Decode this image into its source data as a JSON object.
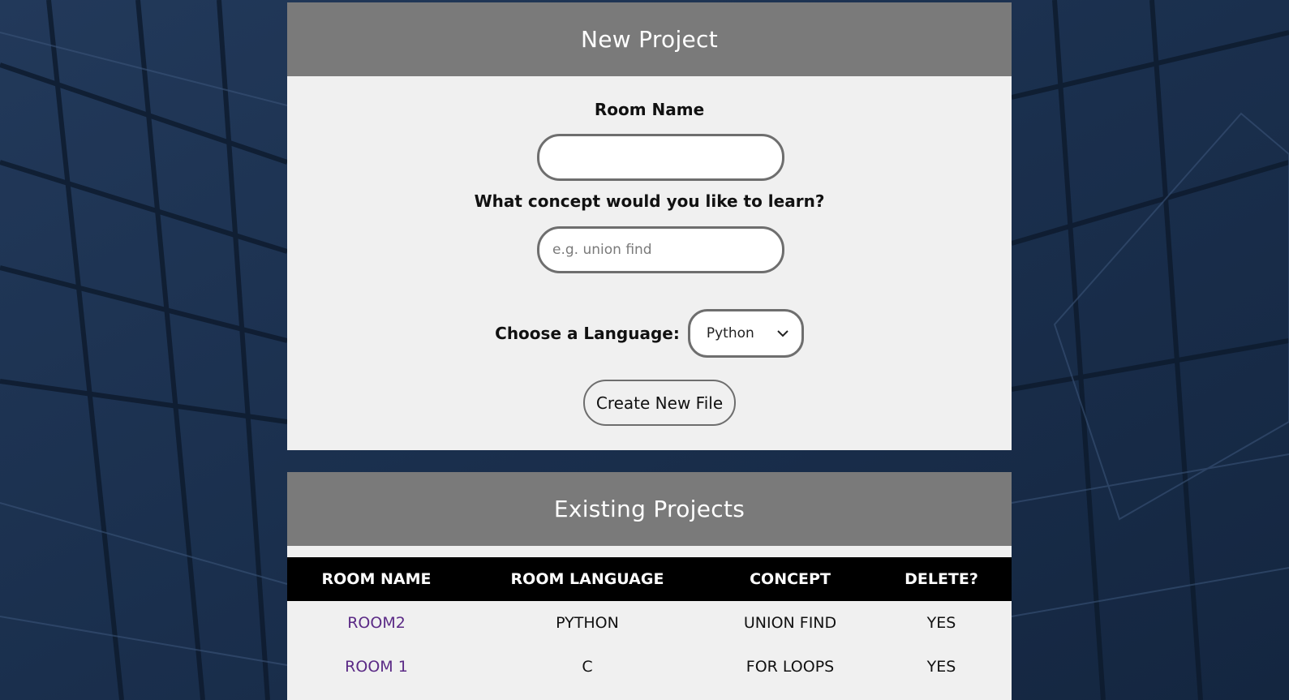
{
  "new_project": {
    "title": "New Project",
    "room_name_label": "Room Name",
    "room_name_value": "",
    "concept_label": "What concept would you like to learn?",
    "concept_placeholder": "e.g. union find",
    "language_label": "Choose a Language:",
    "language_selected": "Python",
    "create_button": "Create New File"
  },
  "existing_projects": {
    "title": "Existing Projects",
    "columns": [
      "ROOM NAME",
      "ROOM LANGUAGE",
      "CONCEPT",
      "DELETE?"
    ],
    "rows": [
      {
        "name": "ROOM2",
        "language": "PYTHON",
        "concept": "UNION FIND",
        "delete": "YES"
      },
      {
        "name": "ROOM 1",
        "language": "C",
        "concept": "FOR LOOPS",
        "delete": "YES"
      }
    ]
  },
  "colors": {
    "header_bg": "#7a7a7a",
    "panel_bg": "#f0f0f0",
    "table_header_bg": "#000000",
    "link": "#5b2a86",
    "background": "#1b3150"
  }
}
